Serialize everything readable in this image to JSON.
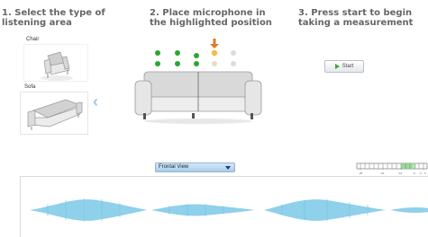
{
  "steps": {
    "step1": "1. Select the type of listening area",
    "step2": "2. Place microphone in the highlighted position",
    "step3": "3. Press start to begin taking a measurement"
  },
  "listening_types": {
    "chair_label": "Chair",
    "sofa_label": "Sofa"
  },
  "start_button": {
    "label": "Start"
  },
  "view_select": {
    "selected": "Frontal View"
  },
  "level_meter": {
    "tick_labels": [
      "-36",
      "-24",
      "-12",
      "-6",
      "-3",
      "0"
    ],
    "highlight_color": "#90e090"
  },
  "colors": {
    "mic_active": "#2fa52f",
    "mic_highlight": "#f0c040",
    "mic_inactive": "#dcdcdc",
    "arrow": "#e07a20",
    "waveform": "#8fd0ea"
  },
  "icons": {
    "back": "chevron-left-icon",
    "start": "play-icon",
    "select": "dropdown-arrow-icon"
  }
}
